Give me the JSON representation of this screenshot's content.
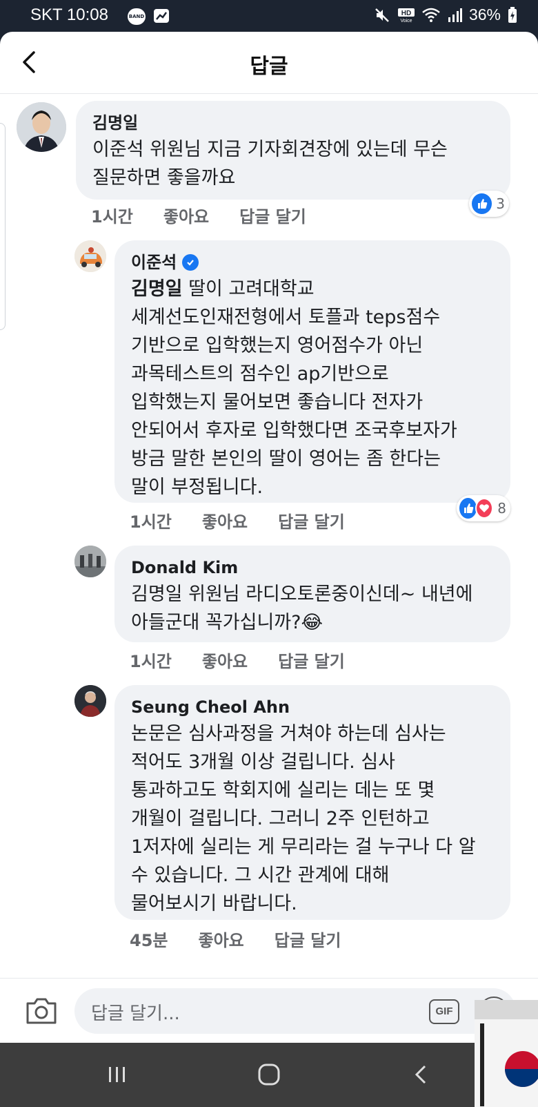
{
  "status": {
    "carrier_time": "SKT 10:08",
    "band_label": "BAND",
    "battery": "36%"
  },
  "header": {
    "title": "답글"
  },
  "comments": [
    {
      "author": "김명일",
      "lines": [
        "이준석 위원님 지금 기자회견장에 있는데 무슨",
        "질문하면 좋을까요"
      ],
      "time": "1시간",
      "like": "좋아요",
      "reply": "답글 달기",
      "reaction_count": "3"
    },
    {
      "author": "이준석",
      "mention": "김명일",
      "lines_after_mention": " 딸이 고려대학교",
      "lines": [
        "세계선도인재전형에서 토플과 teps점수",
        "기반으로 입학했는지 영어점수가 아닌",
        "과목테스트의 점수인 ap기반으로",
        "입학했는지 물어보면 좋습니다  전자가",
        "안되어서 후자로 입학했다면 조국후보자가",
        "방금 말한 본인의 딸이 영어는 좀 한다는",
        "말이 부정됩니다."
      ],
      "time": "1시간",
      "like": "좋아요",
      "reply": "답글 달기",
      "reaction_count": "8"
    },
    {
      "author": "Donald Kim",
      "lines": [
        "김명일 위원님 라디오토론중이신데~ 내년에",
        "아들군대 꼭가십니까?😂"
      ],
      "time": "1시간",
      "like": "좋아요",
      "reply": "답글 달기"
    },
    {
      "author": "Seung Cheol Ahn",
      "lines": [
        "논문은 심사과정을 거쳐야 하는데 심사는",
        "적어도 3개월 이상 걸립니다. 심사",
        "통과하고도 학회지에 실리는 데는 또 몇",
        "개월이 걸립니다. 그러니 2주 인턴하고",
        "1저자에 실리는 게 무리라는 걸 누구나 다 알",
        "수 있습니다. 그 시간 관계에 대해",
        "물어보시기 바랍니다."
      ],
      "time": "45분",
      "like": "좋아요",
      "reply": "답글 달기"
    }
  ],
  "composer": {
    "placeholder": "답글 달기...",
    "gif_label": "GIF"
  },
  "colors": {
    "accent": "#1877f2",
    "love": "#f33e58",
    "bubble": "#f0f2f5"
  }
}
